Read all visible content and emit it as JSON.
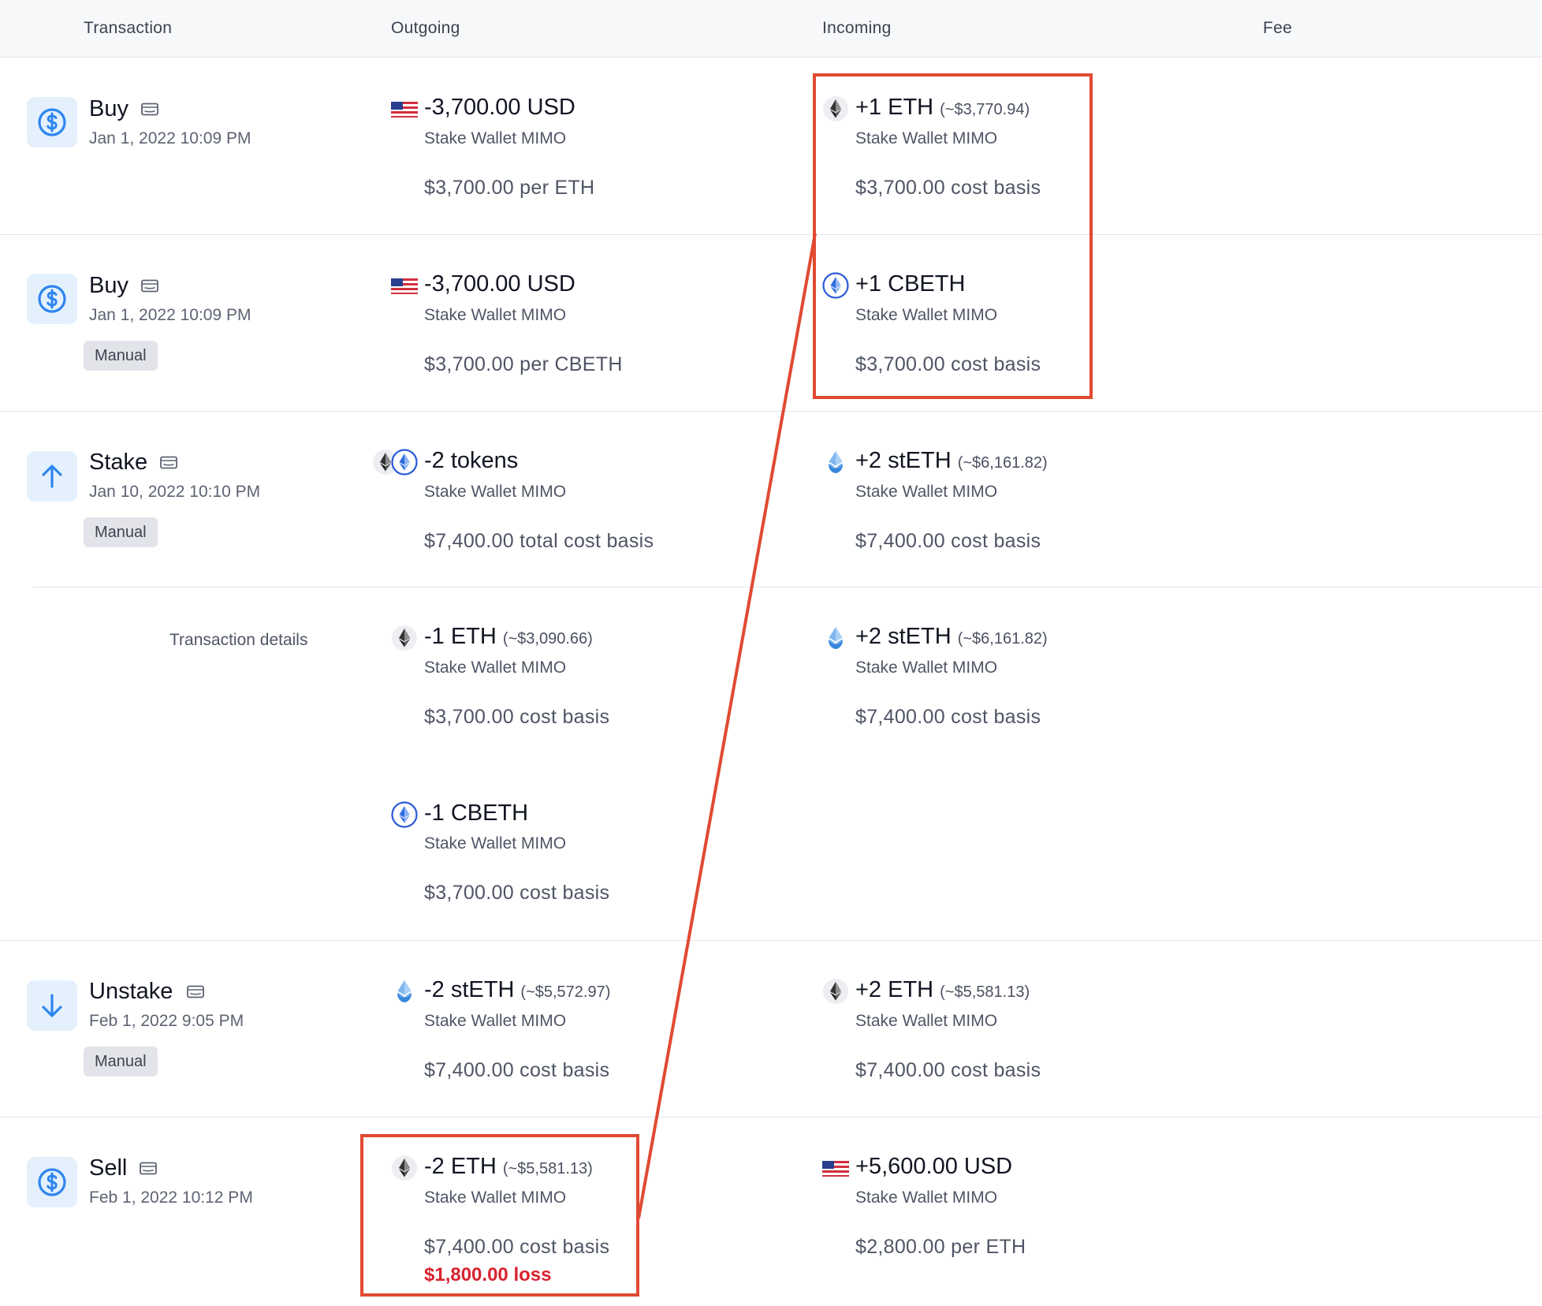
{
  "header": {
    "transaction": "Transaction",
    "outgoing": "Outgoing",
    "incoming": "Incoming",
    "fee": "Fee"
  },
  "rows": [
    {
      "type": "Buy",
      "date": "Jan 1, 2022 10:09 PM",
      "out_amount": "-3,700.00 USD",
      "out_wallet": "Stake Wallet MIMO",
      "out_basis": "$3,700.00 per ETH",
      "in_amount": "+1 ETH",
      "in_approx": "(~$3,770.94)",
      "in_wallet": "Stake Wallet MIMO",
      "in_basis": "$3,700.00 cost basis"
    },
    {
      "type": "Buy",
      "date": "Jan 1, 2022 10:09 PM",
      "badge": "Manual",
      "out_amount": "-3,700.00 USD",
      "out_wallet": "Stake Wallet MIMO",
      "out_basis": "$3,700.00 per CBETH",
      "in_amount": "+1 CBETH",
      "in_wallet": "Stake Wallet MIMO",
      "in_basis": "$3,700.00 cost basis"
    },
    {
      "type": "Stake",
      "date": "Jan 10, 2022 10:10 PM",
      "badge": "Manual",
      "out_amount": "-2 tokens",
      "out_wallet": "Stake Wallet MIMO",
      "out_basis": "$7,400.00 total cost basis",
      "in_amount": "+2 stETH",
      "in_approx": "(~$6,161.82)",
      "in_wallet": "Stake Wallet MIMO",
      "in_basis": "$7,400.00 cost basis"
    },
    {
      "details_label": "Transaction details",
      "out1_amount": "-1 ETH",
      "out1_approx": "(~$3,090.66)",
      "out1_wallet": "Stake Wallet MIMO",
      "out1_basis": "$3,700.00 cost basis",
      "out2_amount": "-1 CBETH",
      "out2_wallet": "Stake Wallet MIMO",
      "out2_basis": "$3,700.00 cost basis",
      "in_amount": "+2 stETH",
      "in_approx": "(~$6,161.82)",
      "in_wallet": "Stake Wallet MIMO",
      "in_basis": "$7,400.00 cost basis"
    },
    {
      "type": "Unstake",
      "date": "Feb 1, 2022 9:05 PM",
      "badge": "Manual",
      "out_amount": "-2 stETH",
      "out_approx": "(~$5,572.97)",
      "out_wallet": "Stake Wallet MIMO",
      "out_basis": "$7,400.00 cost basis",
      "in_amount": "+2 ETH",
      "in_approx": "(~$5,581.13)",
      "in_wallet": "Stake Wallet MIMO",
      "in_basis": "$7,400.00 cost basis"
    },
    {
      "type": "Sell",
      "date": "Feb 1, 2022 10:12 PM",
      "out_amount": "-2 ETH",
      "out_approx": "(~$5,581.13)",
      "out_wallet": "Stake Wallet MIMO",
      "out_basis": "$7,400.00 cost basis",
      "out_loss": "$1,800.00 loss",
      "in_amount": "+5,600.00 USD",
      "in_wallet": "Stake Wallet MIMO",
      "in_basis": "$2,800.00 per ETH"
    }
  ],
  "colors": {
    "highlight": "#e04a32",
    "loss": "#d8232f",
    "icon_blue": "#2f86ee",
    "icon_bg": "#e4f1fd"
  },
  "icons": {
    "buy": "dollar-circle-icon",
    "sell": "dollar-circle-icon",
    "stake": "arrow-up-icon",
    "unstake": "arrow-down-icon",
    "wallet": "wallet-icon",
    "eth": "eth-coin-icon",
    "cbeth": "cbeth-coin-icon",
    "steth": "steth-coin-icon",
    "usd": "us-flag-icon"
  }
}
